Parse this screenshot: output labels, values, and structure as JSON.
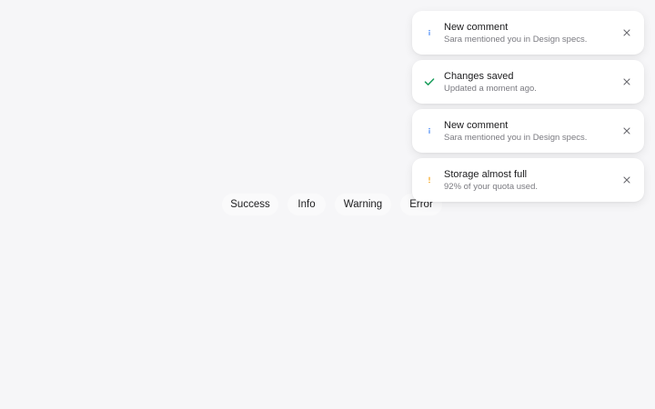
{
  "buttons": [
    {
      "label": "Success"
    },
    {
      "label": "Info"
    },
    {
      "label": "Warning"
    },
    {
      "label": "Error"
    }
  ],
  "colors": {
    "info": "#3b82f6",
    "success": "#1a9e5c",
    "warning": "#f59e0b",
    "close": "#6b6b70"
  },
  "toasts": [
    {
      "type": "info",
      "icon": "info-icon",
      "title": "New comment",
      "description": "Sara mentioned you in Design specs."
    },
    {
      "type": "success",
      "icon": "check-icon",
      "title": "Changes saved",
      "description": "Updated a moment ago."
    },
    {
      "type": "info",
      "icon": "info-icon",
      "title": "New comment",
      "description": "Sara mentioned you in Design specs."
    },
    {
      "type": "warning",
      "icon": "exclamation-icon",
      "title": "Storage almost full",
      "description": "92% of your quota used."
    }
  ]
}
